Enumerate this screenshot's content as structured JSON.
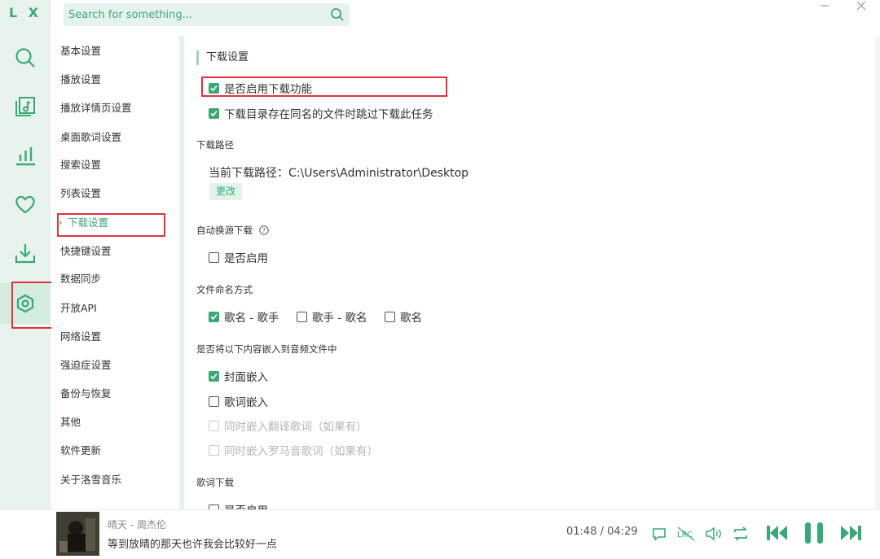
{
  "app": {
    "logo": "L X"
  },
  "search": {
    "placeholder": "Search for something..."
  },
  "nav": {
    "rail": [
      "search-icon",
      "music-list-icon",
      "leaderboard-icon",
      "favorites-icon",
      "download-icon",
      "settings-icon"
    ],
    "active": "settings"
  },
  "settings_menu": {
    "items": [
      "基本设置",
      "播放设置",
      "播放详情页设置",
      "桌面歌词设置",
      "搜索设置",
      "列表设置",
      "下载设置",
      "快捷键设置",
      "数据同步",
      "开放API",
      "网络设置",
      "强迫症设置",
      "备份与恢复",
      "其他",
      "软件更新",
      "关于洛雪音乐"
    ],
    "active_index": 6
  },
  "content": {
    "section_title": "下载设置",
    "enable_download": {
      "label": "是否启用下载功能",
      "checked": true
    },
    "skip_existing": {
      "label": "下载目录存在同名的文件时跳过下载此任务",
      "checked": true
    },
    "path_group_label": "下载路径",
    "current_path": "当前下载路径：C:\\Users\\Administrator\\Desktop",
    "change_button": "更改",
    "auto_source_label": "自动换源下载",
    "auto_source_enable": {
      "label": "是否启用",
      "checked": false
    },
    "naming_label": "文件命名方式",
    "naming_options": [
      {
        "label": "歌名 - 歌手",
        "checked": true
      },
      {
        "label": "歌手 - 歌名",
        "checked": false
      },
      {
        "label": "歌名",
        "checked": false
      }
    ],
    "embed_label": "是否将以下内容嵌入到音频文件中",
    "embed_options": [
      {
        "label": "封面嵌入",
        "checked": true,
        "disabled": false
      },
      {
        "label": "歌词嵌入",
        "checked": false,
        "disabled": false
      },
      {
        "label": "同时嵌入翻译歌词（如果有）",
        "checked": false,
        "disabled": true
      },
      {
        "label": "同时嵌入罗马音歌词（如果有）",
        "checked": false,
        "disabled": true
      }
    ],
    "lyric_download_label": "歌词下载",
    "lyric_download_enable": {
      "label": "是否启用",
      "checked": false
    }
  },
  "player": {
    "song": "晴天 - 周杰伦",
    "lyric": "等到放晴的那天也许我会比较好一点",
    "current_time": "01:48",
    "separator": "/",
    "total_time": "04:29",
    "controls": [
      "comment-icon",
      "lyric-icon",
      "volume-icon",
      "repeat-icon",
      "previous-icon",
      "pause-icon",
      "next-icon"
    ]
  },
  "colors": {
    "accent": "#3aa876",
    "rail_bg": "#e9f3ee",
    "highlight": "#e0313d"
  }
}
